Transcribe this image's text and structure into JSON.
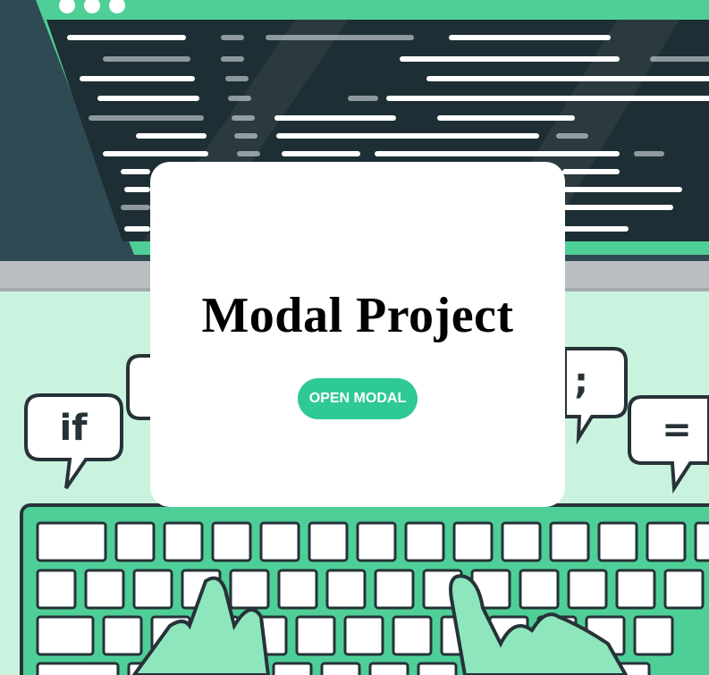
{
  "modal": {
    "title": "Modal Project",
    "open_button_label": "OPEN MODAL"
  },
  "illustration": {
    "bubbles": [
      "if",
      ";",
      "="
    ]
  },
  "colors": {
    "accent": "#2fc996",
    "background": "#c9f3de",
    "code_panel": "#1d2e34",
    "card": "#ffffff"
  }
}
